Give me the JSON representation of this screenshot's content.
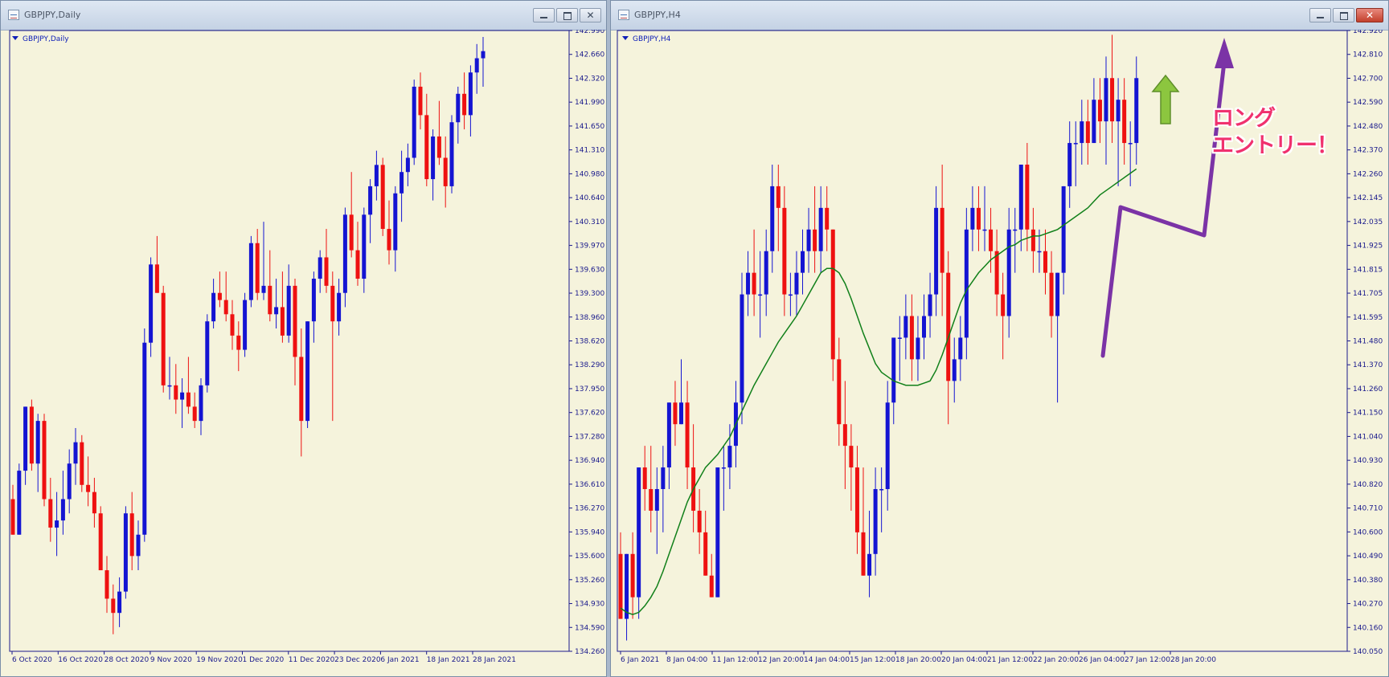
{
  "windows": [
    {
      "title": "GBPJPY,Daily",
      "chart_label": "GBPJPY,Daily",
      "buttons": {
        "minimize": "minimize-icon",
        "maximize": "maximize-icon",
        "close": "close-icon"
      }
    },
    {
      "title": "GBPJPY,H4",
      "chart_label": "GBPJPY,H4",
      "buttons": {
        "minimize": "minimize-icon",
        "maximize": "maximize-icon",
        "close": "close-icon"
      },
      "annotation": {
        "line1": "ロング",
        "line2": "エントリー！"
      }
    }
  ],
  "colors": {
    "background": "#f5f3dc",
    "bull": "#1414d2",
    "bear": "#ee1111",
    "moving_average": "#11801a",
    "axis_text": "#1a1a8c",
    "arrow": "#7b33a6",
    "up_arrow": "#8cc63f"
  },
  "chart_data": [
    {
      "type": "candlestick",
      "symbol": "GBPJPY",
      "timeframe": "Daily",
      "y_ticks": [
        "142.990",
        "142.660",
        "142.320",
        "141.990",
        "141.650",
        "141.310",
        "140.980",
        "140.640",
        "140.310",
        "139.970",
        "139.630",
        "139.300",
        "138.960",
        "138.620",
        "138.290",
        "137.950",
        "137.620",
        "137.280",
        "136.940",
        "136.610",
        "136.270",
        "135.940",
        "135.600",
        "135.260",
        "134.930",
        "134.590",
        "134.260"
      ],
      "x_ticks": [
        "6 Oct 2020",
        "16 Oct 2020",
        "28 Oct 2020",
        "9 Nov 2020",
        "19 Nov 2020",
        "1 Dec 2020",
        "11 Dec 2020",
        "23 Dec 2020",
        "6 Jan 2021",
        "18 Jan 2021",
        "28 Jan 2021"
      ],
      "ylim": [
        134.26,
        142.99
      ],
      "candles": [
        [
          136.4,
          136.6,
          135.9,
          135.9
        ],
        [
          135.9,
          136.9,
          135.9,
          136.8
        ],
        [
          136.8,
          137.7,
          136.6,
          137.7
        ],
        [
          137.7,
          137.8,
          136.8,
          136.9
        ],
        [
          136.9,
          137.6,
          136.5,
          137.5
        ],
        [
          137.5,
          137.6,
          136.3,
          136.4
        ],
        [
          136.4,
          136.7,
          135.8,
          136.0
        ],
        [
          136.0,
          136.5,
          135.6,
          136.1
        ],
        [
          136.1,
          136.8,
          135.9,
          136.4
        ],
        [
          136.4,
          137.1,
          136.2,
          136.9
        ],
        [
          136.9,
          137.4,
          136.6,
          137.2
        ],
        [
          137.2,
          137.3,
          136.5,
          136.6
        ],
        [
          136.6,
          137.0,
          136.3,
          136.5
        ],
        [
          136.5,
          136.7,
          136.0,
          136.2
        ],
        [
          136.2,
          136.3,
          135.6,
          135.4
        ],
        [
          135.4,
          135.6,
          134.8,
          135.0
        ],
        [
          135.0,
          135.2,
          134.5,
          134.8
        ],
        [
          134.8,
          135.3,
          134.6,
          135.1
        ],
        [
          135.1,
          136.3,
          135.0,
          136.2
        ],
        [
          136.2,
          136.5,
          135.4,
          135.6
        ],
        [
          135.6,
          136.1,
          135.4,
          135.9
        ],
        [
          135.9,
          138.8,
          135.8,
          138.6
        ],
        [
          138.6,
          139.8,
          138.4,
          139.7
        ],
        [
          139.7,
          140.1,
          139.3,
          139.3
        ],
        [
          139.3,
          139.4,
          137.9,
          138.0
        ],
        [
          138.0,
          138.4,
          137.8,
          138.0
        ],
        [
          138.0,
          138.3,
          137.6,
          137.8
        ],
        [
          137.8,
          138.1,
          137.4,
          137.9
        ],
        [
          137.9,
          138.4,
          137.6,
          137.7
        ],
        [
          137.7,
          137.9,
          137.4,
          137.5
        ],
        [
          137.5,
          138.1,
          137.3,
          138.0
        ],
        [
          138.0,
          139.0,
          137.9,
          138.9
        ],
        [
          138.9,
          139.5,
          138.8,
          139.3
        ],
        [
          139.3,
          139.6,
          139.1,
          139.2
        ],
        [
          139.2,
          139.6,
          138.9,
          139.0
        ],
        [
          139.0,
          139.2,
          138.5,
          138.7
        ],
        [
          138.7,
          138.9,
          138.2,
          138.5
        ],
        [
          138.5,
          139.3,
          138.4,
          139.2
        ],
        [
          139.2,
          140.1,
          139.1,
          140.0
        ],
        [
          140.0,
          140.2,
          139.2,
          139.3
        ],
        [
          139.3,
          140.3,
          139.2,
          139.4
        ],
        [
          139.4,
          139.9,
          138.9,
          139.0
        ],
        [
          139.0,
          139.5,
          138.8,
          139.1
        ],
        [
          139.1,
          139.6,
          138.6,
          138.7
        ],
        [
          138.7,
          139.7,
          138.6,
          139.4
        ],
        [
          139.4,
          139.5,
          138.0,
          138.4
        ],
        [
          138.4,
          138.8,
          137.0,
          137.5
        ],
        [
          137.5,
          138.9,
          137.4,
          138.9
        ],
        [
          138.9,
          139.6,
          138.6,
          139.5
        ],
        [
          139.5,
          139.9,
          139.3,
          139.8
        ],
        [
          139.8,
          140.2,
          139.3,
          139.4
        ],
        [
          139.4,
          139.6,
          137.5,
          138.9
        ],
        [
          138.9,
          139.5,
          138.7,
          139.3
        ],
        [
          139.3,
          140.5,
          139.1,
          140.4
        ],
        [
          140.4,
          141.0,
          139.8,
          139.9
        ],
        [
          139.9,
          140.3,
          139.4,
          139.5
        ],
        [
          139.5,
          140.5,
          139.3,
          140.4
        ],
        [
          140.4,
          140.9,
          140.0,
          140.8
        ],
        [
          140.8,
          141.3,
          140.6,
          141.1
        ],
        [
          141.1,
          141.2,
          140.1,
          140.2
        ],
        [
          140.2,
          140.6,
          139.7,
          139.9
        ],
        [
          139.9,
          140.8,
          139.6,
          140.7
        ],
        [
          140.7,
          141.3,
          140.3,
          141.0
        ],
        [
          141.0,
          141.4,
          140.8,
          141.2
        ],
        [
          141.2,
          142.3,
          141.1,
          142.2
        ],
        [
          142.2,
          142.4,
          141.6,
          141.8
        ],
        [
          141.8,
          142.1,
          140.8,
          140.9
        ],
        [
          140.9,
          141.6,
          140.6,
          141.5
        ],
        [
          141.5,
          142.0,
          141.1,
          141.2
        ],
        [
          141.2,
          141.5,
          140.5,
          140.8
        ],
        [
          140.8,
          141.8,
          140.7,
          141.7
        ],
        [
          141.7,
          142.2,
          141.4,
          142.1
        ],
        [
          142.1,
          142.4,
          141.6,
          141.8
        ],
        [
          141.8,
          142.5,
          141.5,
          142.4
        ],
        [
          142.4,
          142.8,
          142.1,
          142.6
        ],
        [
          142.6,
          142.9,
          142.2,
          142.7
        ]
      ]
    },
    {
      "type": "candlestick",
      "symbol": "GBPJPY",
      "timeframe": "H4",
      "y_ticks": [
        "142.920",
        "142.810",
        "142.700",
        "142.590",
        "142.480",
        "142.370",
        "142.260",
        "142.145",
        "142.035",
        "141.925",
        "141.815",
        "141.705",
        "141.595",
        "141.480",
        "141.370",
        "141.260",
        "141.150",
        "141.040",
        "140.930",
        "140.820",
        "140.710",
        "140.600",
        "140.490",
        "140.380",
        "140.270",
        "140.160",
        "140.050"
      ],
      "x_ticks": [
        "6 Jan 2021",
        "8 Jan 04:00",
        "11 Jan 12:00",
        "12 Jan 20:00",
        "14 Jan 04:00",
        "15 Jan 12:00",
        "18 Jan 20:00",
        "20 Jan 04:00",
        "21 Jan 12:00",
        "22 Jan 20:00",
        "26 Jan 04:00",
        "27 Jan 12:00",
        "28 Jan 20:00"
      ],
      "ylim": [
        140.05,
        142.92
      ],
      "indicator": "moving average",
      "candles": [
        [
          140.5,
          140.6,
          140.2,
          140.2
        ],
        [
          140.2,
          140.5,
          140.1,
          140.5
        ],
        [
          140.5,
          140.6,
          140.2,
          140.3
        ],
        [
          140.3,
          140.9,
          140.2,
          140.9
        ],
        [
          140.9,
          141.0,
          140.7,
          140.8
        ],
        [
          140.8,
          141.0,
          140.6,
          140.7
        ],
        [
          140.7,
          140.9,
          140.5,
          140.8
        ],
        [
          140.8,
          141.0,
          140.6,
          140.9
        ],
        [
          140.9,
          141.2,
          140.8,
          141.2
        ],
        [
          141.2,
          141.3,
          141.0,
          141.1
        ],
        [
          141.1,
          141.4,
          141.1,
          141.2
        ],
        [
          141.2,
          141.3,
          140.8,
          140.9
        ],
        [
          140.9,
          141.1,
          140.6,
          140.7
        ],
        [
          140.7,
          140.8,
          140.5,
          140.6
        ],
        [
          140.6,
          140.7,
          140.4,
          140.4
        ],
        [
          140.4,
          140.5,
          140.3,
          140.3
        ],
        [
          140.3,
          140.9,
          140.3,
          140.9
        ],
        [
          140.9,
          141.0,
          140.7,
          140.9
        ],
        [
          140.9,
          141.1,
          140.8,
          141.0
        ],
        [
          141.0,
          141.3,
          140.9,
          141.2
        ],
        [
          141.2,
          141.8,
          141.1,
          141.7
        ],
        [
          141.7,
          141.9,
          141.6,
          141.8
        ],
        [
          141.8,
          142.0,
          141.6,
          141.7
        ],
        [
          141.7,
          141.9,
          141.5,
          141.7
        ],
        [
          141.7,
          142.0,
          141.6,
          141.9
        ],
        [
          141.9,
          142.3,
          141.8,
          142.2
        ],
        [
          142.2,
          142.3,
          141.9,
          142.1
        ],
        [
          142.1,
          142.2,
          141.6,
          141.7
        ],
        [
          141.7,
          141.8,
          141.6,
          141.7
        ],
        [
          141.7,
          141.9,
          141.6,
          141.8
        ],
        [
          141.8,
          142.0,
          141.7,
          141.9
        ],
        [
          141.9,
          142.1,
          141.8,
          142.0
        ],
        [
          142.0,
          142.2,
          141.8,
          141.9
        ],
        [
          141.9,
          142.2,
          141.8,
          142.1
        ],
        [
          142.1,
          142.2,
          141.9,
          142.0
        ],
        [
          142.0,
          142.0,
          141.3,
          141.4
        ],
        [
          141.4,
          141.5,
          141.0,
          141.1
        ],
        [
          141.1,
          141.3,
          140.8,
          141.0
        ],
        [
          141.0,
          141.1,
          140.7,
          140.9
        ],
        [
          140.9,
          141.0,
          140.5,
          140.6
        ],
        [
          140.6,
          140.9,
          140.4,
          140.4
        ],
        [
          140.4,
          140.7,
          140.3,
          140.5
        ],
        [
          140.5,
          140.9,
          140.4,
          140.8
        ],
        [
          140.8,
          140.9,
          140.6,
          140.8
        ],
        [
          140.8,
          141.3,
          140.7,
          141.2
        ],
        [
          141.2,
          141.5,
          141.1,
          141.5
        ],
        [
          141.5,
          141.6,
          141.3,
          141.5
        ],
        [
          141.5,
          141.7,
          141.4,
          141.6
        ],
        [
          141.6,
          141.7,
          141.3,
          141.4
        ],
        [
          141.4,
          141.6,
          141.3,
          141.5
        ],
        [
          141.5,
          141.7,
          141.4,
          141.6
        ],
        [
          141.6,
          141.8,
          141.5,
          141.7
        ],
        [
          141.7,
          142.2,
          141.6,
          142.1
        ],
        [
          142.1,
          142.3,
          141.6,
          141.8
        ],
        [
          141.8,
          141.9,
          141.1,
          141.3
        ],
        [
          141.3,
          141.5,
          141.2,
          141.4
        ],
        [
          141.4,
          141.6,
          141.3,
          141.5
        ],
        [
          141.5,
          142.1,
          141.4,
          142.0
        ],
        [
          142.0,
          142.2,
          141.9,
          142.1
        ],
        [
          142.1,
          142.2,
          141.9,
          142.0
        ],
        [
          142.0,
          142.2,
          141.9,
          142.0
        ],
        [
          142.0,
          142.1,
          141.8,
          141.9
        ],
        [
          141.9,
          142.0,
          141.6,
          141.7
        ],
        [
          141.7,
          141.8,
          141.4,
          141.6
        ],
        [
          141.6,
          142.1,
          141.5,
          142.0
        ],
        [
          142.0,
          142.1,
          141.8,
          142.0
        ],
        [
          142.0,
          142.3,
          141.9,
          142.3
        ],
        [
          142.3,
          142.4,
          141.9,
          142.0
        ],
        [
          142.0,
          142.1,
          141.8,
          141.9
        ],
        [
          141.9,
          142.0,
          141.8,
          141.9
        ],
        [
          141.9,
          142.0,
          141.7,
          141.8
        ],
        [
          141.8,
          141.9,
          141.5,
          141.6
        ],
        [
          141.6,
          141.8,
          141.2,
          141.8
        ],
        [
          141.8,
          142.2,
          141.7,
          142.2
        ],
        [
          142.2,
          142.5,
          142.1,
          142.4
        ],
        [
          142.4,
          142.5,
          142.2,
          142.4
        ],
        [
          142.4,
          142.6,
          142.3,
          142.5
        ],
        [
          142.5,
          142.6,
          142.3,
          142.4
        ],
        [
          142.4,
          142.7,
          142.4,
          142.6
        ],
        [
          142.6,
          142.7,
          142.4,
          142.5
        ],
        [
          142.5,
          142.8,
          142.3,
          142.7
        ],
        [
          142.7,
          142.9,
          142.4,
          142.5
        ],
        [
          142.5,
          142.7,
          142.2,
          142.6
        ],
        [
          142.6,
          142.7,
          142.3,
          142.4
        ],
        [
          142.4,
          142.5,
          142.2,
          142.4
        ],
        [
          142.4,
          142.8,
          142.3,
          142.7
        ]
      ],
      "ma": [
        140.25,
        140.23,
        140.22,
        140.23,
        140.26,
        140.3,
        140.35,
        140.42,
        140.5,
        140.58,
        140.66,
        140.74,
        140.8,
        140.85,
        140.9,
        140.93,
        140.96,
        141.0,
        141.04,
        141.1,
        141.16,
        141.22,
        141.28,
        141.33,
        141.38,
        141.43,
        141.48,
        141.52,
        141.56,
        141.6,
        141.65,
        141.7,
        141.75,
        141.8,
        141.82,
        141.82,
        141.8,
        141.75,
        141.68,
        141.6,
        141.52,
        141.45,
        141.38,
        141.34,
        141.32,
        141.3,
        141.29,
        141.28,
        141.28,
        141.28,
        141.29,
        141.3,
        141.35,
        141.42,
        141.5,
        141.58,
        141.66,
        141.72,
        141.76,
        141.8,
        141.83,
        141.86,
        141.88,
        141.9,
        141.92,
        141.93,
        141.95,
        141.96,
        141.97,
        141.97,
        141.98,
        141.99,
        142.0,
        142.02,
        142.04,
        142.06,
        142.08,
        142.1,
        142.13,
        142.16,
        142.18,
        142.2,
        142.22,
        142.24,
        142.26,
        142.28
      ]
    }
  ]
}
